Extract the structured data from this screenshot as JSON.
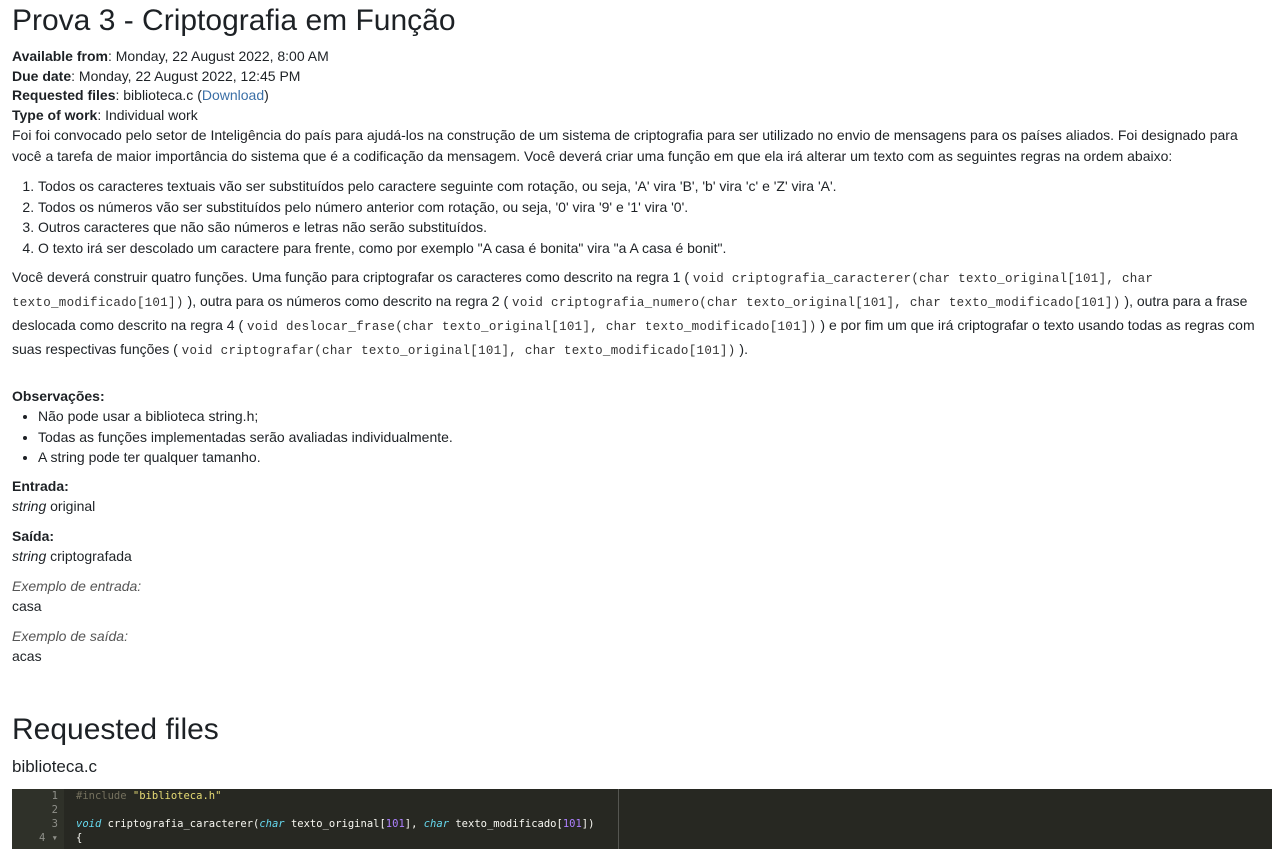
{
  "title": "Prova 3 - Criptografia em Função",
  "meta": {
    "available_label": "Available from",
    "available_value": ": Monday, 22 August 2022, 8:00 AM",
    "due_label": "Due date",
    "due_value": ": Monday, 22 August 2022, 12:45 PM",
    "files_label": "Requested files",
    "files_value": ": biblioteca.c (",
    "download": "Download",
    "files_close": ")",
    "work_label": "Type of work",
    "work_value": ": Individual work"
  },
  "intro": "Foi foi convocado pelo setor de Inteligência do país para ajudá-los na construção de um sistema de criptografia para ser utilizado no envio de mensagens para os países aliados. Foi designado para você a tarefa de maior importância do sistema que é a codificação da mensagem. Você deverá criar uma função em que ela irá alterar um texto com as seguintes regras na ordem abaixo:",
  "rules": [
    "Todos os caracteres textuais vão ser substituídos pelo caractere seguinte com rotação, ou seja, 'A' vira 'B', 'b' vira 'c' e 'Z' vira 'A'.",
    "Todos os números vão ser substituídos pelo número anterior com rotação, ou seja, '0' vira '9' e '1' vira '0'.",
    "Outros caracteres que não são números e letras não serão substituídos.",
    "O texto irá ser descolado um caractere para frente, como por exemplo \"A casa é bonita\" vira \"a A casa é bonit\"."
  ],
  "functions": {
    "t1": "Você deverá construir quatro funções. Uma função para criptografar os caracteres como descrito na regra 1 ( ",
    "c1": "void criptografia_caracterer(char texto_original[101], char texto_modificado[101])",
    "t2": " ), outra para os números como descrito na regra 2 ( ",
    "c2": "void criptografia_numero(char texto_original[101], char texto_modificado[101])",
    "t3": " ), outra para a frase deslocada como descrito na regra 4 ( ",
    "c3": "void deslocar_frase(char texto_original[101], char texto_modificado[101])",
    "t4": " ) e por fim um que irá criptografar o texto usando todas as regras com suas respectivas funções ( ",
    "c4": "void criptografar(char texto_original[101], char texto_modificado[101])",
    "t5": " )."
  },
  "observacoes": {
    "heading": "Observações:",
    "items": [
      "Não pode usar a biblioteca string.h;",
      "Todas as funções implementadas serão avaliadas individualmente.",
      "A string pode ter qualquer tamanho."
    ]
  },
  "entrada": {
    "heading": "Entrada:",
    "type": "string",
    "rest": " original"
  },
  "saida": {
    "heading": "Saída:",
    "type": "string",
    "rest": " criptografada"
  },
  "exemplo_entrada": {
    "label": "Exemplo de entrada:",
    "value": "casa"
  },
  "exemplo_saida": {
    "label": "Exemplo de saída:",
    "value": "acas"
  },
  "requested": {
    "heading": "Requested files",
    "filename": "biblioteca.c",
    "line_numbers": [
      "1",
      "2",
      "3",
      "4 ▾"
    ],
    "code": {
      "l1_inc": "#include ",
      "l1_str": "\"biblioteca.h\"",
      "l3_kw": "void",
      "l3_fn": " criptografia_caracterer(",
      "l3_t1": "char",
      "l3_a1": " texto_original[",
      "l3_n1": "101",
      "l3_a2": "], ",
      "l3_t2": "char",
      "l3_a3": " texto_modificado[",
      "l3_n2": "101",
      "l3_a4": "])",
      "l4": "{"
    }
  }
}
